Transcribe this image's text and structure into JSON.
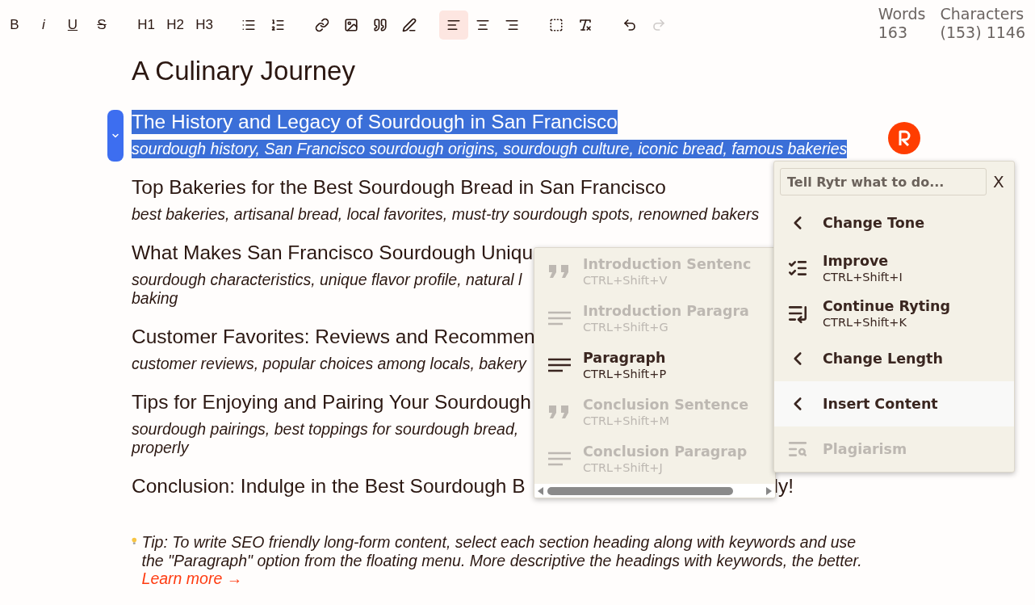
{
  "toolbar": {
    "groups": [
      [
        {
          "kind": "bold",
          "label": "B",
          "selected": false
        },
        {
          "kind": "italic",
          "label": "i",
          "selected": false
        },
        {
          "kind": "underline",
          "label": "U",
          "selected": false
        },
        {
          "kind": "strike",
          "label": "S",
          "selected": false
        }
      ],
      [
        {
          "kind": "heading",
          "label": "H1",
          "selected": false
        },
        {
          "kind": "heading",
          "label": "H2",
          "selected": false
        },
        {
          "kind": "heading",
          "label": "H3",
          "selected": false
        }
      ],
      [
        {
          "kind": "bullets",
          "selected": false
        },
        {
          "kind": "numbers",
          "selected": false
        }
      ],
      [
        {
          "kind": "link",
          "selected": false
        },
        {
          "kind": "image",
          "selected": false
        },
        {
          "kind": "quote",
          "selected": false
        },
        {
          "kind": "highlight",
          "selected": false
        }
      ],
      [
        {
          "kind": "align-left",
          "selected": true
        },
        {
          "kind": "align-center",
          "selected": false
        },
        {
          "kind": "align-right",
          "selected": false
        }
      ],
      [
        {
          "kind": "select-all",
          "selected": false
        },
        {
          "kind": "clear-format",
          "selected": false
        }
      ],
      [
        {
          "kind": "undo",
          "disabled": false
        },
        {
          "kind": "redo",
          "disabled": true
        }
      ]
    ]
  },
  "stats": [
    {
      "label": "Words",
      "value": "163"
    },
    {
      "label": "Characters",
      "value": "(153) 1146"
    }
  ],
  "document": {
    "title": "A Culinary Journey",
    "sections": [
      {
        "heading": "The History and Legacy of Sourdough in San Francisco",
        "keywords": [
          "sourdough history, San Francisco sourdough origins, sourdough culture, iconic bread, famous bakeries"
        ],
        "selected": true
      },
      {
        "heading": "Top Bakeries for the Best Sourdough Bread in San Francisco",
        "keywords": [
          "best bakeries, artisanal bread, local favorites, must-try sourdough spots, renowned bakers"
        ],
        "selected": false
      },
      {
        "heading": "What Makes San Francisco Sourdough Uniqu",
        "keywords": [
          "sourdough characteristics, unique flavor profile, natural l",
          "baking"
        ],
        "selected": false
      },
      {
        "heading": "Customer Favorites: Reviews and Recommen",
        "keywords": [
          "customer reviews, popular choices among locals, bakery"
        ],
        "selected": false
      },
      {
        "heading": "Tips for Enjoying and Pairing Your Sourdough",
        "keywords": [
          "sourdough pairings, best toppings for sourdough bread,",
          "properly"
        ],
        "selected": false
      },
      {
        "heading": "Conclusion: Indulge in the Best Sourdough B",
        "heading_tail": "ly!",
        "selected": false
      }
    ],
    "tip": {
      "text": "Tip: To write SEO friendly long-form content, select each section heading along with keywords and use the \"Paragraph\" option from the floating menu. More descriptive the headings with keywords, the better.",
      "link": "Learn more →"
    }
  },
  "submenu": {
    "items": [
      {
        "kind": "quote",
        "label": "Introduction Sentenc",
        "shortcut": "CTRL+Shift+V",
        "disabled": true
      },
      {
        "kind": "lines",
        "label": "Introduction Paragra",
        "shortcut": "CTRL+Shift+G",
        "disabled": true
      },
      {
        "kind": "lines",
        "label": "Paragraph",
        "shortcut": "CTRL+Shift+P",
        "disabled": false
      },
      {
        "kind": "quote",
        "label": "Conclusion Sentence",
        "shortcut": "CTRL+Shift+M",
        "disabled": true
      },
      {
        "kind": "lines",
        "label": "Conclusion Paragrap",
        "shortcut": "CTRL+Shift+J",
        "disabled": true
      }
    ]
  },
  "rytr_menu": {
    "placeholder": "Tell Rytr what to do...",
    "close": "X",
    "items": [
      {
        "kind": "chevron",
        "label": "Change Tone",
        "selected": false,
        "disabled": false
      },
      {
        "kind": "improve",
        "label": "Improve",
        "shortcut": "CTRL+Shift+I",
        "selected": false,
        "disabled": false
      },
      {
        "kind": "continue",
        "label": "Continue Ryting",
        "shortcut": "CTRL+Shift+K",
        "selected": false,
        "disabled": false
      },
      {
        "kind": "chevron",
        "label": "Change Length",
        "selected": false,
        "disabled": false
      },
      {
        "kind": "chevron",
        "label": "Insert Content",
        "selected": true,
        "disabled": false
      },
      {
        "kind": "plagiarism",
        "label": "Plagiarism",
        "selected": false,
        "disabled": true
      }
    ]
  }
}
